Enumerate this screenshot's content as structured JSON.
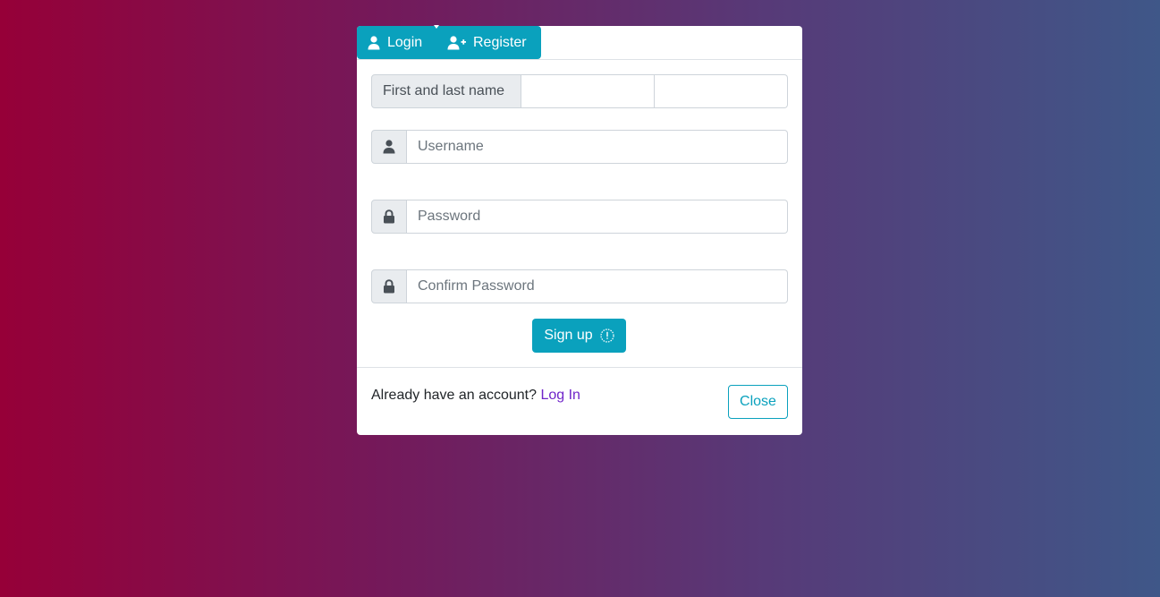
{
  "tabs": {
    "login_label": "Login",
    "login_icon": "user-icon",
    "register_label": "Register",
    "register_icon": "user-plus-icon"
  },
  "form": {
    "name_label": "First and last name",
    "first_name_value": "",
    "last_name_value": "",
    "username_placeholder": "Username",
    "username_icon": "user-icon",
    "password_placeholder": "Password",
    "password_icon": "lock-icon",
    "confirm_password_placeholder": "Confirm Password",
    "confirm_password_icon": "lock-icon",
    "signup_label": "Sign up",
    "signup_icon": "exclamation-circle-icon"
  },
  "footer": {
    "prompt_text": "Already have an account?",
    "login_link": "Log In",
    "close_label": "Close"
  },
  "colors": {
    "accent": "#0aa1bd",
    "link": "#6f24c9",
    "gradient_start": "#960038",
    "gradient_end": "#3f5788"
  }
}
